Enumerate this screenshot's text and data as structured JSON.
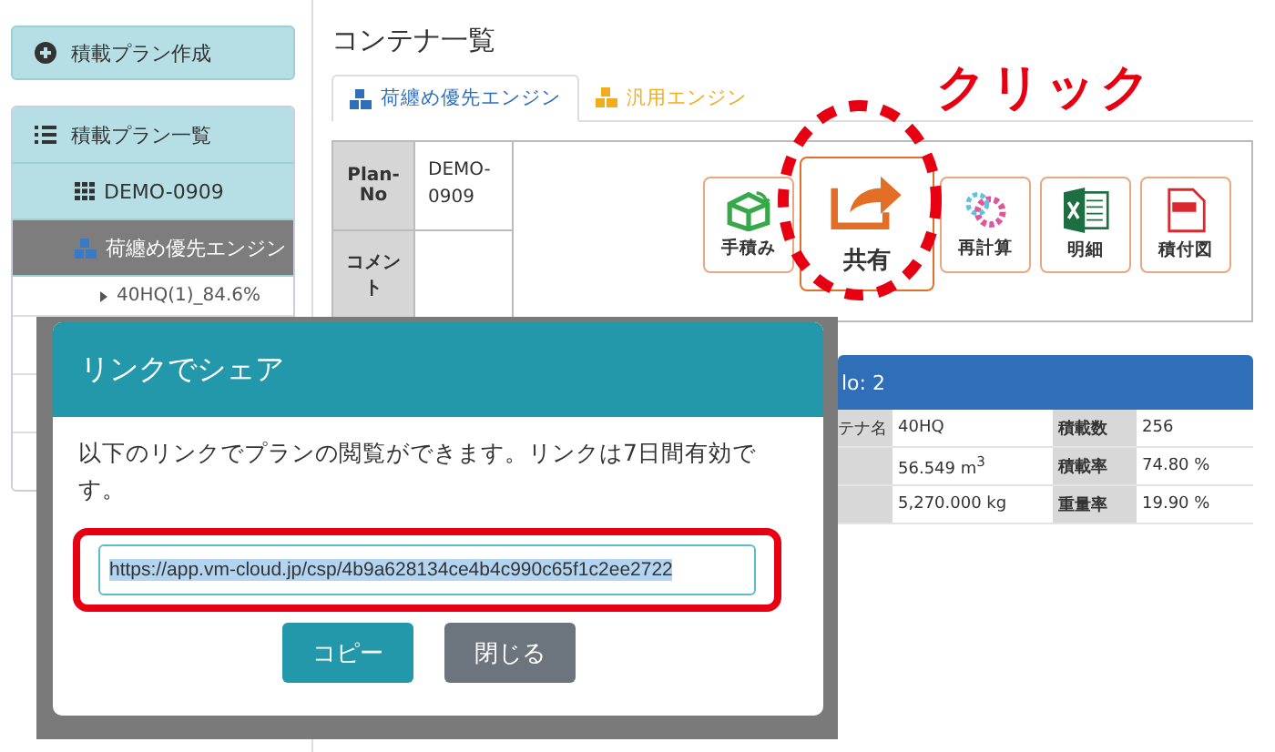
{
  "sidebar": {
    "create_button": "積載プラン作成",
    "list_header": "積載プラン一覧",
    "items": [
      {
        "label": "DEMO-0909",
        "selected": false
      },
      {
        "label": "荷纏め優先エンジン",
        "selected": true
      }
    ],
    "tree": [
      {
        "label": "40HQ(1)_84.6%",
        "expanded": false
      }
    ]
  },
  "page_title": "コンテナ一覧",
  "tabs": [
    {
      "label": "荷纏め優先エンジン",
      "selected": true,
      "color": "#2f6fb7"
    },
    {
      "label": "汎用エンジン",
      "selected": false,
      "color": "#f0ad1e"
    }
  ],
  "plan_table": {
    "rows": [
      {
        "label": "Plan-No",
        "value": "DEMO-0909"
      },
      {
        "label": "コメント",
        "value": ""
      }
    ]
  },
  "actions": [
    {
      "label": "手積み",
      "kind": "hand",
      "highlighted": false
    },
    {
      "label": "共有",
      "kind": "share",
      "highlighted": true
    },
    {
      "label": "再計算",
      "kind": "gear",
      "highlighted": false
    },
    {
      "label": "明細",
      "kind": "excel",
      "highlighted": false
    },
    {
      "label": "積付図",
      "kind": "pdf",
      "highlighted": false
    }
  ],
  "annotation": {
    "text": "クリック"
  },
  "container_panel": {
    "title": "lo: 2",
    "rows": [
      [
        "テナ名",
        "40HQ",
        "積載数",
        "256"
      ],
      [
        "",
        "56.549 m$^{3}$",
        "積載率",
        "74.80 %"
      ],
      [
        "",
        "5,270.000 kg",
        "重量率",
        "19.90 %"
      ]
    ]
  },
  "dialog": {
    "title": "リンクでシェア",
    "message": "以下のリンクでプランの閲覧ができます。リンクは7日間有効です。",
    "url": "https://app.vm-cloud.jp/csp/4b9a628134ce4b4c990c65f1c2ee2722",
    "url_selected": true,
    "buttons": [
      {
        "label": "コピー",
        "kind": "primary"
      },
      {
        "label": "閉じる",
        "kind": "secondary"
      }
    ]
  }
}
